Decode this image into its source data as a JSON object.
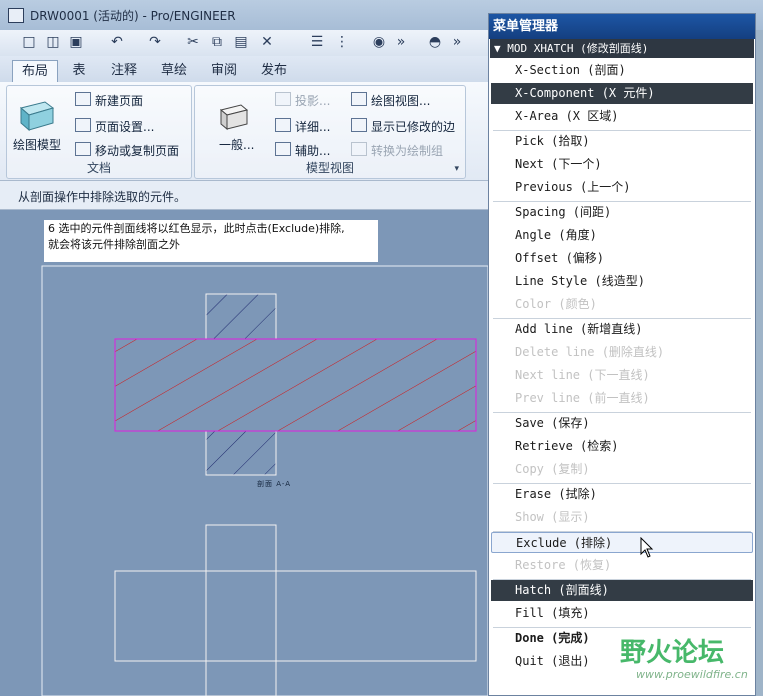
{
  "window": {
    "title": "DRW0001 (活动的) - Pro/ENGINEER"
  },
  "toolbar": {
    "icons": [
      "new-icon",
      "open-icon",
      "save-icon",
      "undo-icon",
      "redo-icon",
      "cut-icon",
      "copy-icon",
      "paste-icon",
      "delete-icon",
      "layers-icon",
      "tree-icon",
      "find-icon",
      "more-icon",
      "regen-icon",
      "more-icon"
    ]
  },
  "tabs": [
    "布局",
    "表",
    "注释",
    "草绘",
    "审阅",
    "发布"
  ],
  "ribbon": {
    "doc_group": {
      "label": "文档",
      "main_button": "绘图模型",
      "new_page": "新建页面",
      "page_setup": "页面设置...",
      "move_copy": "移动或复制页面"
    },
    "view_group": {
      "label": "模型视图",
      "general": "一般...",
      "projection": "投影...",
      "detail": "详细...",
      "auxiliary": "辅助...",
      "drawing_view": "绘图视图...",
      "show_modified": "显示已修改的边",
      "convert": "转换为绘制组"
    }
  },
  "message": "从剖面操作中排除选取的元件。",
  "note": {
    "line1": "6 选中的元件剖面线将以红色显示，此时点击(Exclude)排除,",
    "line2": "就会将该元件排除剖面之外"
  },
  "drawing": {
    "section_label": "剖面  A-A"
  },
  "menu": {
    "title": "菜单管理器",
    "header": "MOD XHATCH (修改剖面线)",
    "items": [
      {
        "label": "X-Section (剖面)",
        "state": "normal"
      },
      {
        "label": "X-Component (X 元件)",
        "state": "selected"
      },
      {
        "label": "X-Area (X 区域)",
        "state": "normal"
      },
      {
        "label": "Pick (拾取)",
        "state": "normal"
      },
      {
        "label": "Next (下一个)",
        "state": "normal"
      },
      {
        "label": "Previous (上一个)",
        "state": "normal"
      },
      {
        "label": "Spacing (间距)",
        "state": "normal"
      },
      {
        "label": "Angle (角度)",
        "state": "normal"
      },
      {
        "label": "Offset (偏移)",
        "state": "normal"
      },
      {
        "label": "Line Style (线造型)",
        "state": "normal"
      },
      {
        "label": "Color (颜色)",
        "state": "disabled"
      },
      {
        "label": "Add line (新增直线)",
        "state": "normal"
      },
      {
        "label": "Delete line (删除直线)",
        "state": "disabled"
      },
      {
        "label": "Next line (下一直线)",
        "state": "disabled"
      },
      {
        "label": "Prev line (前一直线)",
        "state": "disabled"
      },
      {
        "label": "Save (保存)",
        "state": "normal"
      },
      {
        "label": "Retrieve (检索)",
        "state": "normal"
      },
      {
        "label": "Copy (复制)",
        "state": "disabled"
      },
      {
        "label": "Erase (拭除)",
        "state": "normal"
      },
      {
        "label": "Show (显示)",
        "state": "disabled"
      },
      {
        "label": "Exclude (排除)",
        "state": "hover"
      },
      {
        "label": "Restore (恢复)",
        "state": "disabled"
      },
      {
        "label": "Hatch (剖面线)",
        "state": "selected"
      },
      {
        "label": "Fill (填充)",
        "state": "normal"
      },
      {
        "label": "Done (完成)",
        "state": "bold"
      },
      {
        "label": "Quit (退出)",
        "state": "normal"
      }
    ]
  },
  "watermark": {
    "text": "野火论坛",
    "url": "www.proewildfire.cn"
  },
  "colors": {
    "section_hatch": "#d01818",
    "part_hatch": "#1f2a6e",
    "canvas": "#7d97b7",
    "menu_selected": "#333c45"
  }
}
